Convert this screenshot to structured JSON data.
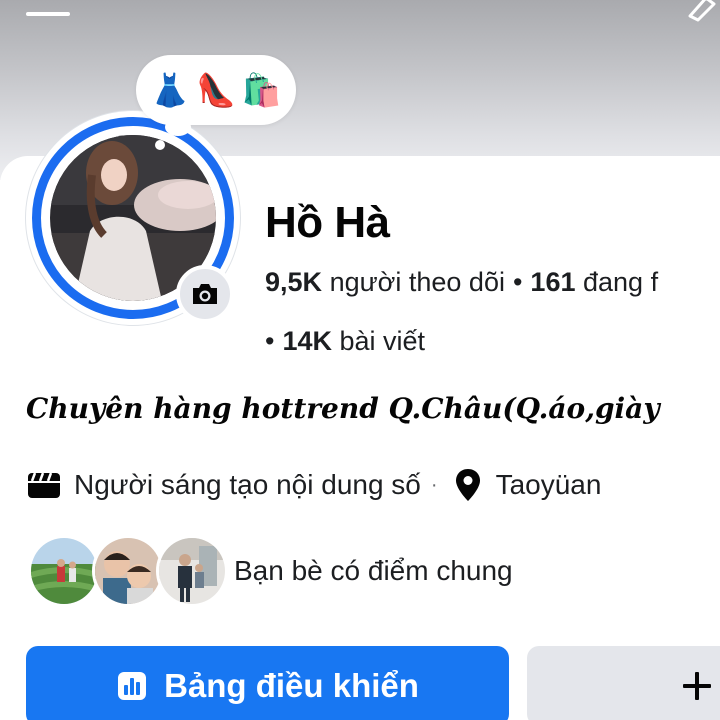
{
  "cover": {},
  "note": {
    "emojis": [
      "👗",
      "👠",
      "🛍️"
    ]
  },
  "profile": {
    "name": "Hồ Hà",
    "followers_count": "9,5K",
    "followers_label": "người theo dõi",
    "separator": "•",
    "following_count": "161",
    "following_label": "đang f",
    "posts_count": "14K",
    "posts_label": "bài viết"
  },
  "bio": "Chuyên hàng hottrend Q.Châu(Q.áo,giày",
  "info": {
    "category": "Người sáng tạo nội dung số",
    "separator": "·",
    "location": "Taoyüan"
  },
  "mutual_friends": {
    "label": "Bạn bè có điểm chung"
  },
  "actions": {
    "dashboard_label": "Bảng điều khiển"
  },
  "colors": {
    "accent": "#1877f2",
    "story_ring": "#1b6cf0",
    "secondary_button": "#e4e6eb"
  },
  "icons": {
    "menu": "menu-bar-icon",
    "edit": "pencil-icon",
    "camera": "camera-icon",
    "category": "clapperboard-icon",
    "location": "location-pin-icon",
    "dashboard": "bar-chart-icon",
    "add": "plus-icon"
  }
}
